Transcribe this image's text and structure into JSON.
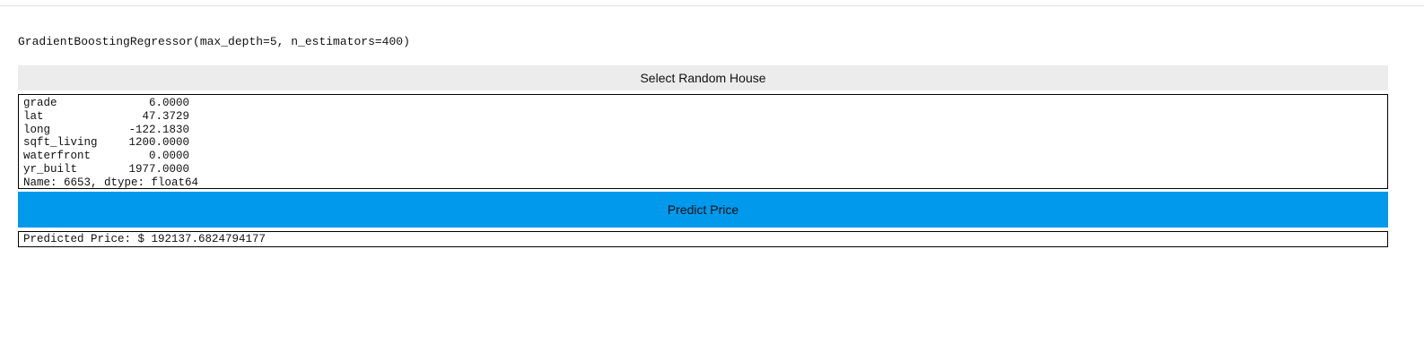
{
  "model": {
    "repr": "GradientBoostingRegressor(max_depth=5, n_estimators=400)"
  },
  "buttons": {
    "select_random_house": "Select Random House",
    "predict_price": "Predict Price"
  },
  "house": {
    "features": [
      {
        "name": "grade",
        "value": "6.0000"
      },
      {
        "name": "lat",
        "value": "47.3729"
      },
      {
        "name": "long",
        "value": "-122.1830"
      },
      {
        "name": "sqft_living",
        "value": "1200.0000"
      },
      {
        "name": "waterfront",
        "value": "0.0000"
      },
      {
        "name": "yr_built",
        "value": "1977.0000"
      }
    ],
    "footer": "Name: 6653, dtype: float64"
  },
  "prediction": {
    "text": "Predicted Price: $ 192137.6824794177"
  },
  "colors": {
    "predict_button": "#0099ec",
    "select_button": "#ececec"
  }
}
